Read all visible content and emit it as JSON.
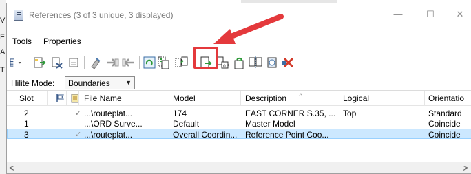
{
  "window": {
    "title": "References (3 of 3 unique, 3 displayed)",
    "controls": {
      "minimize": "—",
      "maximize": "☐",
      "close": "✕"
    }
  },
  "background": {
    "left_strip_text": [
      "V",
      "F",
      "A",
      "T"
    ]
  },
  "menu": {
    "items": [
      "Tools",
      "Properties"
    ]
  },
  "toolbar": {
    "icons": [
      "tree-dropdown",
      "attach-reference",
      "detach-reference",
      "detach-all",
      "reload-reference",
      "exchange-reference",
      "reload-all",
      "rotate-view",
      "copy-attachment",
      "move-reference",
      "copy-reference",
      "scale-reference",
      "rotate-reference",
      "mirror-reference",
      "clip-boundary",
      "delete-clip"
    ],
    "highlighted_icon": "copy-attachment"
  },
  "hilite": {
    "label": "Hilite Mode:",
    "value": "Boundaries"
  },
  "table": {
    "columns": [
      "Slot",
      "",
      "",
      "File Name",
      "Model",
      "Description",
      "Logical",
      "Orientatio"
    ],
    "rows": [
      {
        "slot": "2",
        "check": "✓",
        "file": "...\\routeplat...",
        "model": "174",
        "description": "EAST CORNER S.35, ...",
        "logical": "Top",
        "orientation": "Standard"
      },
      {
        "slot": "1",
        "check": "",
        "file": "...\\ORD Surve...",
        "model": "Default",
        "description": "Master Model",
        "logical": "",
        "orientation": "Coincide"
      },
      {
        "slot": "3",
        "check": "✓",
        "file": "...\\routeplat...",
        "model": "Overall Coordin...",
        "description": "Reference Point Coo...",
        "logical": "",
        "orientation": "Coincide"
      }
    ],
    "selected_row": 2
  },
  "scroll": {
    "left": "<",
    "right": ">"
  },
  "colors": {
    "highlight": "#e4393c",
    "selection": "#cce8ff"
  }
}
